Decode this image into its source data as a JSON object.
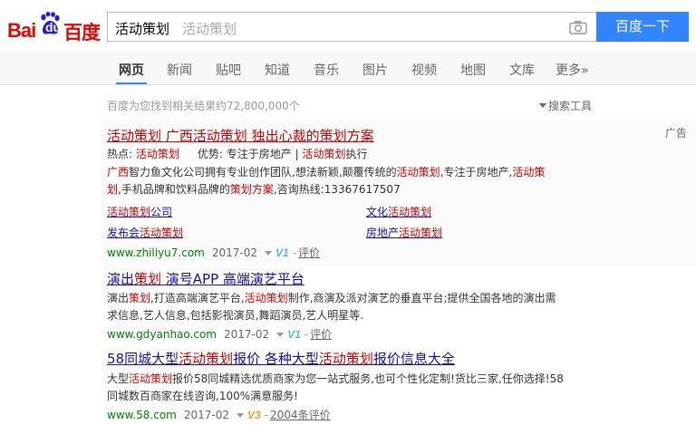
{
  "header": {
    "logo_bai": "Bai",
    "logo_du": "du",
    "logo_cn": "百度",
    "query": "活动策划",
    "suggestion": "活动策划",
    "search_button": "百度一下"
  },
  "nav": {
    "tabs": [
      {
        "label": "网页",
        "active": true
      },
      {
        "label": "新闻"
      },
      {
        "label": "贴吧"
      },
      {
        "label": "知道"
      },
      {
        "label": "音乐"
      },
      {
        "label": "图片"
      },
      {
        "label": "视频"
      },
      {
        "label": "地图"
      },
      {
        "label": "文库"
      },
      {
        "label": "更多»"
      }
    ]
  },
  "meta": {
    "result_count": "百度为您找到相关结果约72,800,000个",
    "search_tools": "搜索工具",
    "ad_label": "广告"
  },
  "results": [
    {
      "title_parts": [
        "活动策划",
        " 广西",
        "活动策划",
        " 独出心裁的",
        "策划方案"
      ],
      "hot_label": "热点:",
      "hot_value": "活动策划",
      "adv_label": "优势:",
      "adv_value": "专注于房地产",
      "adv_bar": " | ",
      "adv_kw": "活动策划",
      "adv_tail": "执行",
      "desc1_parts": [
        "广西",
        "智力鱼文化公司拥有专业创作团队,想法新颖,颠覆传统的",
        "活动策划",
        ",专注于房地产,",
        "活动策"
      ],
      "desc2_parts": [
        "划",
        ",手机品牌和饮料品牌的",
        "策划方案",
        ",咨询热线:13367617507"
      ],
      "sublinks": [
        {
          "pre": "",
          "kw": "活动策划",
          "post": "公司"
        },
        {
          "pre": "文化",
          "kw": "活动策划",
          "post": ""
        },
        {
          "pre": "发布会",
          "kw": "活动策划",
          "post": ""
        },
        {
          "pre": "房地产",
          "kw": "活动策划",
          "post": ""
        }
      ],
      "url": "www.zhiliyu7.com",
      "date": "2017-02",
      "badge": "V1",
      "sep": "-",
      "eval": "评价"
    },
    {
      "title_parts": [
        "演出",
        "策划",
        " 演号APP 高端演艺平台"
      ],
      "desc1_parts": [
        "演出",
        "策划",
        ",打造高端演艺平台,",
        "活动策划",
        "制作,商演及派对演艺的垂直平台;提供全国各地的演出需"
      ],
      "desc2": "求信息,艺人信息,包括影视演员,舞蹈演员,艺人明星等.",
      "url": "www.gdyanhao.com",
      "date": "2017-02",
      "badge": "V1",
      "sep": "-",
      "eval": "评价"
    },
    {
      "title_parts": [
        "58同城大型",
        "活动策划",
        "报价 各种大型",
        "活动策划",
        "报价信息大全"
      ],
      "desc1_parts": [
        "大型",
        "活动策划",
        "报价58同城精选优质商家为您一站式服务,也可个性化定制!货比三家,任你选择!58"
      ],
      "desc2": "同城数百商家在线咨询,100%满意服务!",
      "url": "www.58.com",
      "date": "2017-02",
      "badge": "V3",
      "sep": "-",
      "eval": "2004条评价"
    }
  ],
  "colors": {
    "brand_red": "#e10602",
    "brand_blue": "#3385ff",
    "link": "#1a0dab",
    "keyword": "#cc0000",
    "url_green": "#008000"
  }
}
